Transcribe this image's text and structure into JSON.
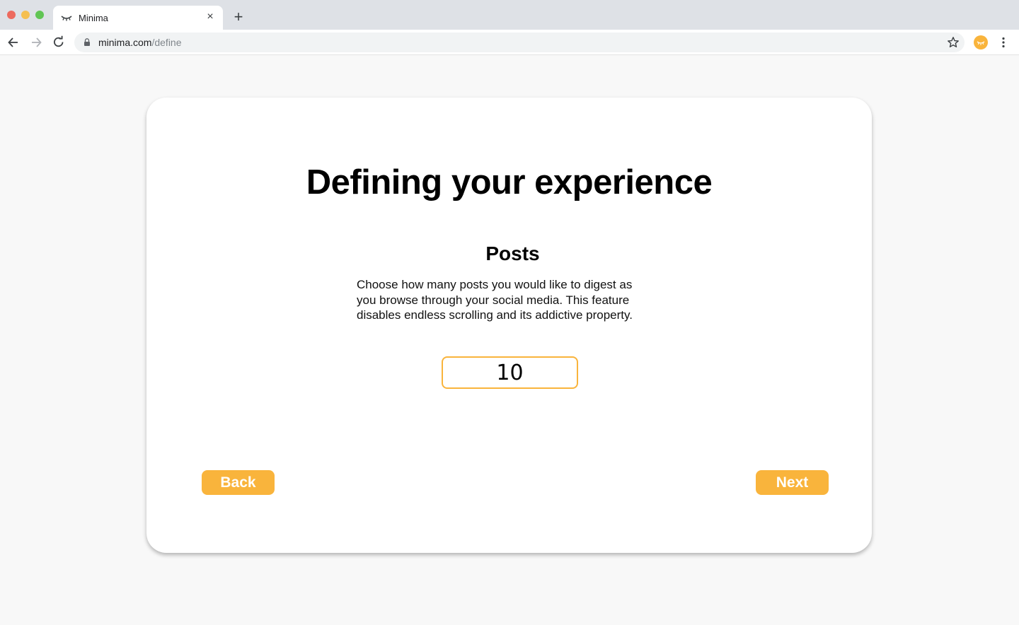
{
  "browser": {
    "tab_title": "Minima",
    "tab_close": "×",
    "new_tab": "+",
    "url_host": "minima.com",
    "url_path": "/define",
    "accent_color": "#f9b43c"
  },
  "page": {
    "title": "Defining your experience",
    "section_title": "Posts",
    "description_lines": [
      "Choose how many posts you would like to digest as",
      "you browse through your social media. This feature",
      "disables endless scrolling and its addictive property."
    ],
    "posts_value": "10",
    "back_label": "Back",
    "next_label": "Next"
  }
}
